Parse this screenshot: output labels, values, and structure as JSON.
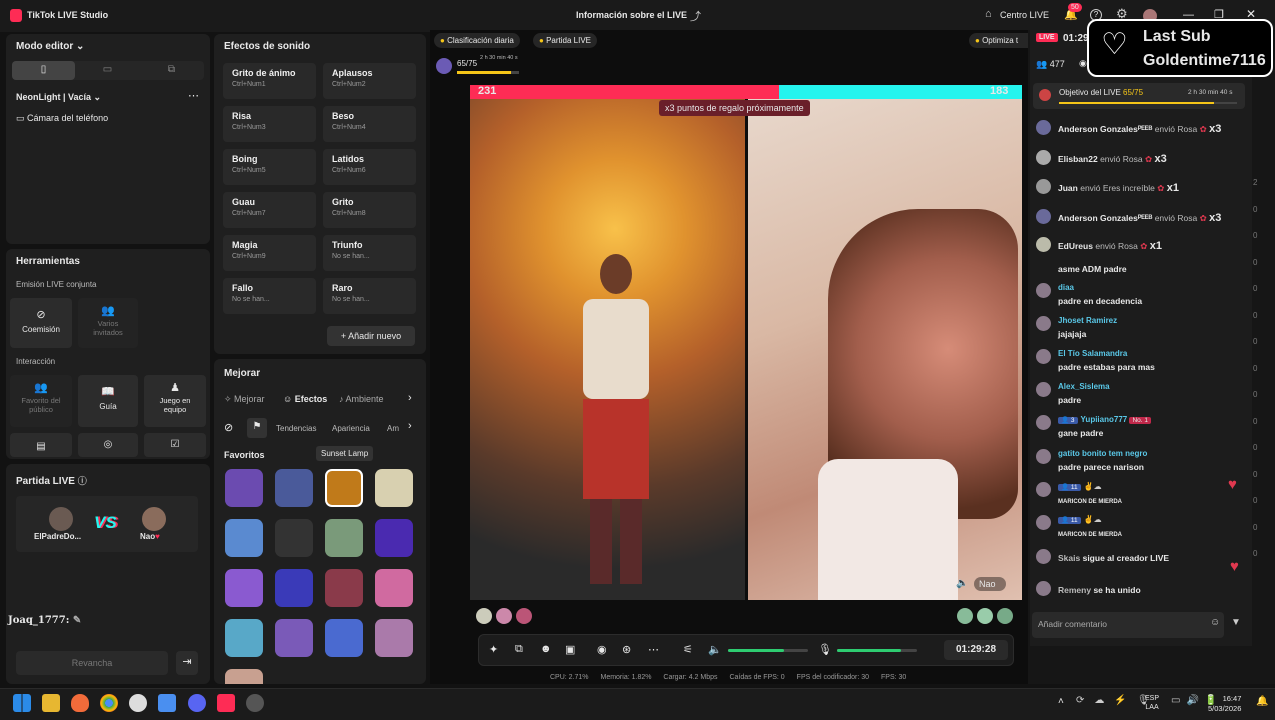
{
  "app": {
    "title": "TikTok LIVE Studio",
    "center_title": "Información sobre el LIVE",
    "centro_live": "Centro LIVE",
    "notif_count": "50"
  },
  "left": {
    "modo_editor": "Modo editor",
    "scene_name": "NeonLight | Vacía",
    "camera_source": "Cámara del teléfono",
    "herramientas": "Herramientas",
    "emision_conjunta": "Emisión LIVE conjunta",
    "coemision": "Coemisión",
    "varios_invitados": "Varios invitados",
    "interaccion": "Interacción",
    "favorito_publico": "Favorito del público",
    "guia": "Guía",
    "juego_equipo": "Juego en equipo",
    "partida_live": "Partida LIVE",
    "player1": "ElPadreDo...",
    "player2": "Nao",
    "vs": "VS",
    "overlay_user": "Joaq_1777:",
    "revancha": "Revancha"
  },
  "sounds": {
    "title": "Efectos de sonido",
    "items": [
      {
        "name": "Grito de ánimo",
        "key": "Ctrl+Num1"
      },
      {
        "name": "Aplausos",
        "key": "Ctrl+Num2"
      },
      {
        "name": "Risa",
        "key": "Ctrl+Num3"
      },
      {
        "name": "Beso",
        "key": "Ctrl+Num4"
      },
      {
        "name": "Boing",
        "key": "Ctrl+Num5"
      },
      {
        "name": "Latidos",
        "key": "Ctrl+Num6"
      },
      {
        "name": "Guau",
        "key": "Ctrl+Num7"
      },
      {
        "name": "Grito",
        "key": "Ctrl+Num8"
      },
      {
        "name": "Magia",
        "key": "Ctrl+Num9"
      },
      {
        "name": "Triunfo",
        "key": "No se han..."
      },
      {
        "name": "Fallo",
        "key": "No se han..."
      },
      {
        "name": "Raro",
        "key": "No se han..."
      }
    ],
    "add_new": "Añadir nuevo"
  },
  "enhance": {
    "title": "Mejorar",
    "tabs": [
      "Mejorar",
      "Efectos",
      "Ambiente"
    ],
    "subtabs": [
      "Tendencias",
      "Apariencia",
      "Am"
    ],
    "favoritos": "Favoritos",
    "tooltip": "Sunset Lamp"
  },
  "stream": {
    "daily_rank": "Clasificación diaria",
    "partida_live": "Partida LIVE",
    "optimize": "Optimiza t",
    "goal_progress": "65/75",
    "goal_time": "2 h 30 min 40 s",
    "score_left": "231",
    "score_right": "183",
    "gift_banner": "x3 puntos de regalo próximamente",
    "right_name": "Nao",
    "timer": "01:29:28",
    "goal_fraction": 0.87,
    "score_fraction_left": 0.56,
    "volume_level": 0.7,
    "mic_level": 0.8
  },
  "stats": {
    "cpu": "CPU:  2.71%",
    "mem": "Memoria:  1.82%",
    "upload": "Cargar:  4.2 Mbps",
    "drops": "Caídas de FPS:  0",
    "enc": "FPS del codificador:  30",
    "fps": "FPS:  30"
  },
  "chat": {
    "live_badge": "LIVE",
    "time": "01:29",
    "viewers": "477",
    "goal_label": "Objetivo del LIVE",
    "goal_value": "65/75",
    "goal_time": "2 h 30 min 40 s",
    "gifts": [
      {
        "user": "Anderson Gonzalesᴾᴱᴱᴮ",
        "action": "envió Rosa",
        "mult": "x3"
      },
      {
        "user": "Elisban22",
        "action": "envió Rosa",
        "mult": "x3"
      },
      {
        "user": "Juan",
        "action": "envió Eres increíble",
        "mult": "x1"
      },
      {
        "user": "Anderson Gonzalesᴾᴱᴱᴮ",
        "action": "envió Rosa",
        "mult": "x3"
      },
      {
        "user": "EdUreus",
        "action": "envió Rosa",
        "mult": "x1"
      }
    ],
    "messages": [
      {
        "user": "",
        "text": "asme ADM padre"
      },
      {
        "user": "diaa",
        "text": "padre en decadencia"
      },
      {
        "user": "Jhoset Ramirez",
        "text": "jajajaja"
      },
      {
        "user": "El Tío Salamandra",
        "text": "padre estabas para mas"
      },
      {
        "user": "Alex_Sislema",
        "text": "padre"
      },
      {
        "user": "Yupiiano777",
        "text": "gane padre",
        "badge": "No. 1",
        "level": "3"
      },
      {
        "user": "gatito bonito tem negro",
        "text": "padre parece narison"
      },
      {
        "user": "",
        "text": "MARICON DE MIERDA",
        "level": "11"
      },
      {
        "user": "",
        "text": "MARICON DE MIERDA",
        "level": "11"
      },
      {
        "user": "Skais",
        "text": "sigue al creador LIVE"
      },
      {
        "user": "Remeny",
        "text": "se ha unido"
      }
    ],
    "comment_placeholder": "Añadir comentario"
  },
  "last_sub": {
    "title": "Last Sub",
    "name": "Goldentime7116"
  },
  "taskbar": {
    "lang1": "ESP",
    "lang2": "LAA",
    "time": "16:47",
    "date": "5/03/2026"
  },
  "colors": {
    "accent": "#fe2c55",
    "teal": "#25f4ee",
    "green": "#2ecc71"
  }
}
